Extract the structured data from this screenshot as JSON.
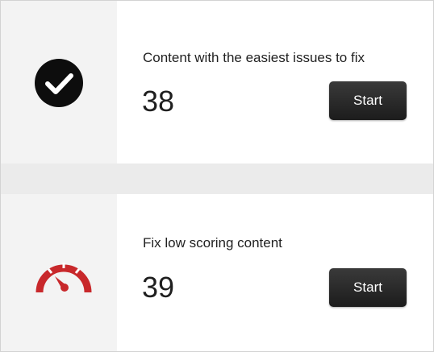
{
  "items": [
    {
      "title": "Content with the easiest issues to fix",
      "count": "38",
      "button_label": "Start",
      "icon": "check-circle-icon"
    },
    {
      "title": "Fix low scoring content",
      "count": "39",
      "button_label": "Start",
      "icon": "gauge-icon"
    }
  ],
  "colors": {
    "icon_dark": "#0d0d0d",
    "gauge_red": "#c8282b",
    "button_bg": "#262626",
    "page_bg": "#ebebeb"
  }
}
